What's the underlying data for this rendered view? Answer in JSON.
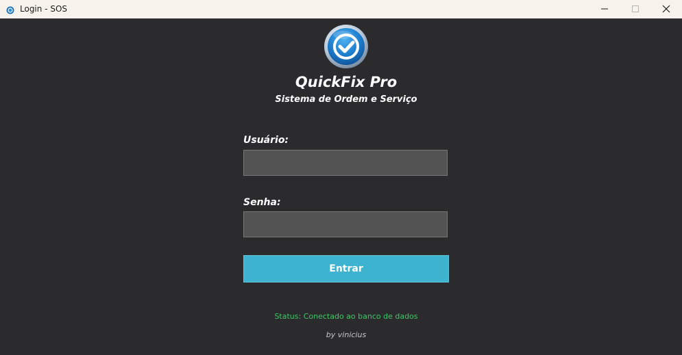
{
  "window": {
    "title": "Login - SOS"
  },
  "icons": {
    "app_icon": "app-icon",
    "logo": "check-circle-icon",
    "minimize": "minimize-icon",
    "maximize": "maximize-icon",
    "close": "close-icon"
  },
  "header": {
    "app_name": "QuickFix Pro",
    "subtitle": "Sistema de Ordem e Serviço"
  },
  "form": {
    "user_label": "Usuário:",
    "user_value": "",
    "password_label": "Senha:",
    "password_value": "",
    "submit_label": "Entrar"
  },
  "footer": {
    "status": "Status: Conectado ao banco de dados",
    "credit": "by vinicius"
  },
  "colors": {
    "background": "#2b2b2d",
    "titlebar": "#f7f3ec",
    "input": "#525252",
    "accent": "#3db3cf",
    "status_ok": "#3ec76a"
  }
}
